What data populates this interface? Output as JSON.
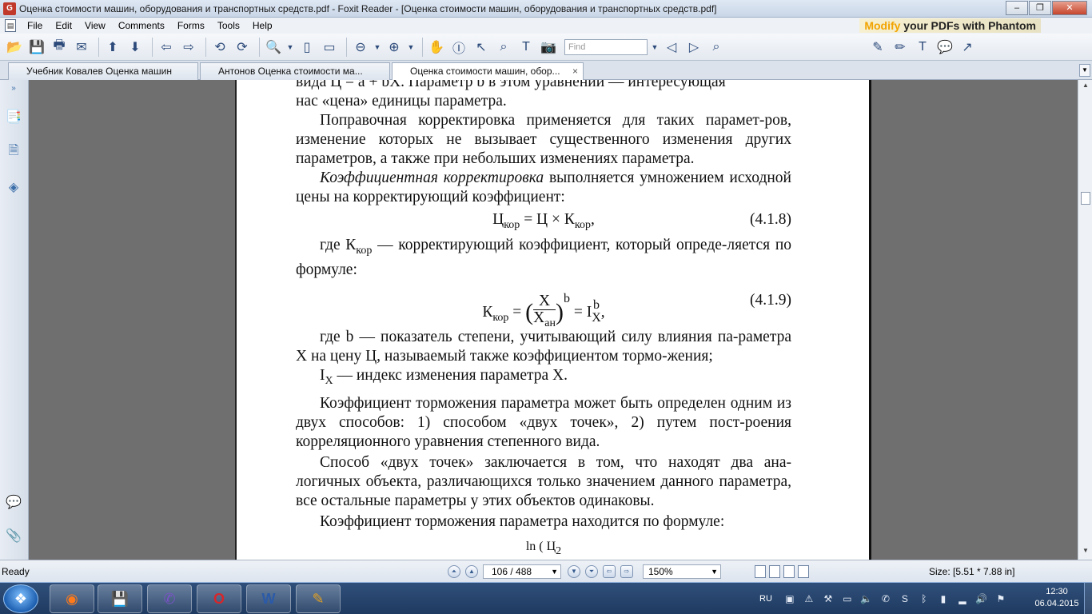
{
  "window": {
    "title": "Оценка стоимости машин, оборудования и транспортных средств.pdf - Foxit Reader - [Оценка стоимости машин, оборудования и транспортных средств.pdf]",
    "minimize": "–",
    "restore": "❐",
    "close": "✕"
  },
  "menu": [
    "File",
    "Edit",
    "View",
    "Comments",
    "Forms",
    "Tools",
    "Help"
  ],
  "promo": {
    "part1": "Modify",
    "part2": " your PDFs with Phantom"
  },
  "toolbar": {
    "find_placeholder": "Find"
  },
  "tabs": [
    {
      "label": "Учебник Ковалев Оценка машин"
    },
    {
      "label": "Антонов Оценка стоимости ма..."
    },
    {
      "label": "Оценка стоимости машин, обор...",
      "close": "×"
    }
  ],
  "document": {
    "line_top": "вида Ц = a + bX. Параметр b в этом уравнении — интересующая",
    "p1_end": "нас «цена» единицы параметра.",
    "p2": "Поправочная корректировка применяется для таких парамет-ров, изменение которых не вызывает существенного изменения других параметров, а также при небольших изменениях параметра.",
    "p3_ital": "Коэффициентная корректировка",
    "p3_rest": " выполняется умножением исходной цены на корректирующий коэффициент:",
    "eq1": {
      "lhs": "Ц",
      "lhs_sub": "кор",
      "mid": " = Ц × К",
      "mid_sub": "кор",
      "tail": ",",
      "num": "(4.1.8)"
    },
    "p4_a": "где К",
    "p4_sub": "кор",
    "p4_b": " — корректирующий коэффициент, который опреде-ляется по формуле:",
    "eq2": {
      "lhs": "К",
      "lhs_sub": "кор",
      "eq": " = ",
      "numer": "X",
      "denom": "X",
      "denom_sub": "ан",
      "power": "b",
      "rhs": " = I",
      "rhs_sup": "b",
      "rhs_sub": "X",
      "tail": ",",
      "num": "(4.1.9)"
    },
    "p5": "где b — показатель степени, учитывающий силу влияния па-раметра X на цену Ц, называемый также коэффициентом тормо-жения;",
    "p6_a": "I",
    "p6_sub": "X",
    "p6_b": " — индекс изменения параметра X.",
    "p7": "Коэффициент торможения параметра может быть определен одним из двух способов: 1) способом «двух точек», 2) путем пост-роения корреляционного уравнения степенного вида.",
    "p8": "Способ «двух точек» заключается в том, что находят два ана-логичных объекта, различающихся только значением данного параметра, все остальные параметры у этих объектов одинаковы.",
    "p9": "Коэффициент торможения параметра находится по формуле:",
    "eq3_partial": "ln ( Ц",
    "eq3_sub": "2"
  },
  "status": {
    "ready": "Ready",
    "page": "106 / 488",
    "zoom": "150%",
    "size": "Size: [5.51 * 7.88 in]"
  },
  "taskbar": {
    "lang": "RU",
    "time": "12:30",
    "date": "06.04.2015"
  }
}
